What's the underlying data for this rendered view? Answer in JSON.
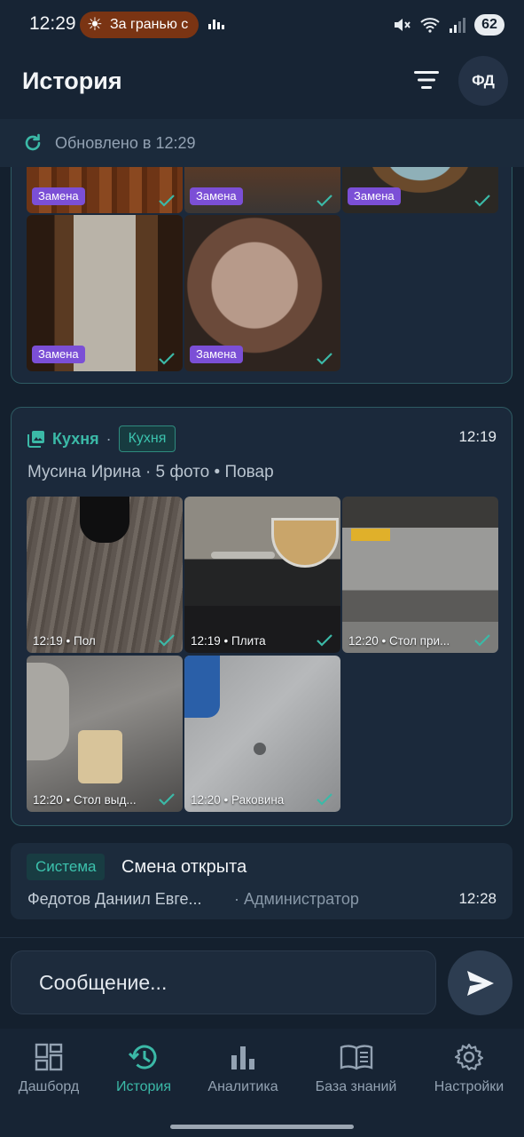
{
  "status_bar": {
    "time": "12:29",
    "live_activity": "За гранью с",
    "battery": "62"
  },
  "header": {
    "title": "История",
    "avatar_initials": "ФД"
  },
  "updated": {
    "text": "Обновлено в 12:29"
  },
  "card1": {
    "photos": [
      {
        "badge": "Замена"
      },
      {
        "badge": "Замена"
      },
      {
        "badge": "Замена"
      },
      {
        "badge": "Замена"
      },
      {
        "badge": "Замена"
      }
    ]
  },
  "card2": {
    "category": "Кухня",
    "tag": "Кухня",
    "time": "12:19",
    "subtitle": "Мусина Ирина · 5 фото • Повар",
    "photos": [
      {
        "caption": "12:19 • Пол"
      },
      {
        "caption": "12:19 • Плита"
      },
      {
        "caption": "12:20 • Стол при..."
      },
      {
        "caption": "12:20 • Стол выд..."
      },
      {
        "caption": "12:20 • Раковина"
      }
    ]
  },
  "system_card": {
    "tag": "Система",
    "title": "Смена открыта",
    "user": "Федотов Даниил Евге...",
    "role": "· Администратор",
    "time": "12:28"
  },
  "composer": {
    "placeholder": "Сообщение..."
  },
  "nav": {
    "items": [
      {
        "label": "Дашборд",
        "icon": "dashboard-icon"
      },
      {
        "label": "История",
        "icon": "history-icon",
        "active": true
      },
      {
        "label": "Аналитика",
        "icon": "analytics-icon"
      },
      {
        "label": "База знаний",
        "icon": "book-icon"
      },
      {
        "label": "Настройки",
        "icon": "gear-icon"
      }
    ]
  },
  "colors": {
    "accent": "#3bb9a7",
    "badge": "#7b4fd6",
    "background": "#14202e"
  }
}
